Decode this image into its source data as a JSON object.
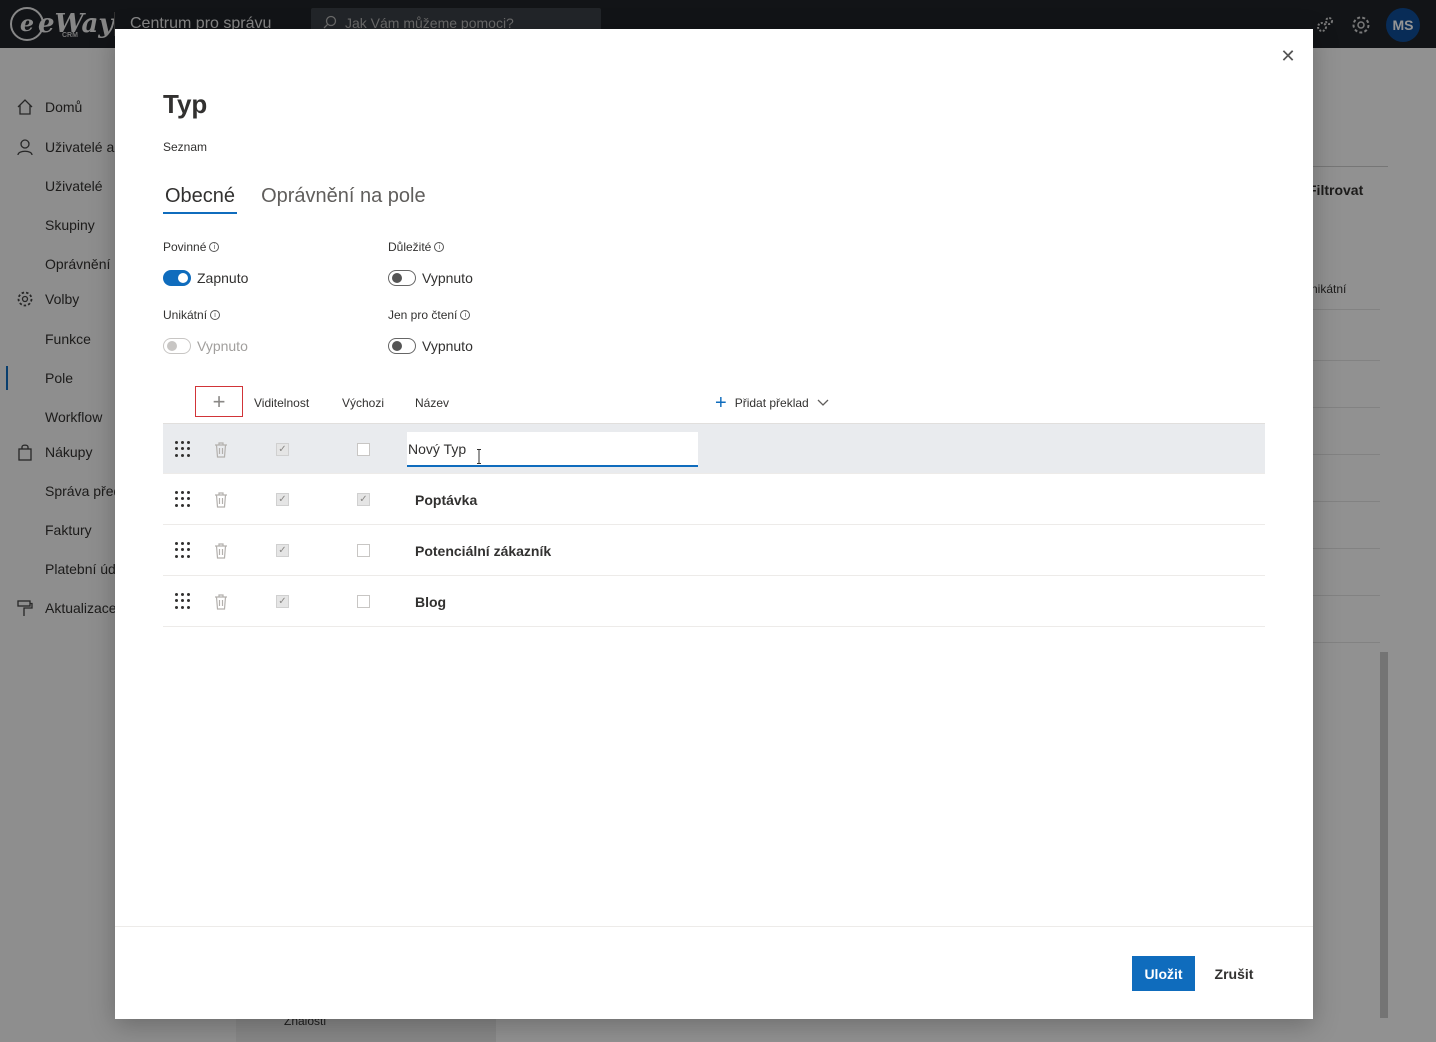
{
  "app": {
    "logo_text": "eWay",
    "logo_sub": "CRM",
    "title": "Centrum pro správu",
    "search_placeholder": "Jak Vám můžeme pomoci?",
    "user_initials": "MS"
  },
  "sidebar": {
    "items": [
      {
        "label": "Domů",
        "icon": "home-icon"
      },
      {
        "label": "Uživatelé a",
        "icon": "person-icon"
      },
      {
        "label": "Uživatelé"
      },
      {
        "label": "Skupiny"
      },
      {
        "label": "Oprávnění n"
      },
      {
        "label": "Volby",
        "icon": "gear-icon"
      },
      {
        "label": "Funkce"
      },
      {
        "label": "Pole"
      },
      {
        "label": "Workflow"
      },
      {
        "label": "Nákupy",
        "icon": "bag-icon"
      },
      {
        "label": "Správa před"
      },
      {
        "label": "Faktury"
      },
      {
        "label": "Platební úd"
      },
      {
        "label": "Aktualizace",
        "icon": "paint-roller-icon"
      }
    ],
    "bottom_label": "Znalosti"
  },
  "background": {
    "filter_label": "Filtrovat",
    "column_label": "nikátní"
  },
  "modal": {
    "title": "Typ",
    "subtitle": "Seznam",
    "tabs": [
      {
        "label": "Obecné",
        "active": true
      },
      {
        "label": "Oprávnění na pole",
        "active": false
      }
    ],
    "fields": {
      "required": {
        "label": "Povinné",
        "value": "Zapnuto",
        "state": "on"
      },
      "important": {
        "label": "Důležité",
        "value": "Vypnuto",
        "state": "off"
      },
      "unique": {
        "label": "Unikátní",
        "value": "Vypnuto",
        "state": "disabled"
      },
      "readonly": {
        "label": "Jen pro čtení",
        "value": "Vypnuto",
        "state": "off"
      }
    },
    "grid": {
      "headers": {
        "visibility": "Viditelnost",
        "default": "Výchozi",
        "name": "Název",
        "add_translation": "Přidat překlad"
      },
      "rows": [
        {
          "name": "Nový Typ",
          "visible": true,
          "default": false,
          "editing": true
        },
        {
          "name": "Poptávka",
          "visible": true,
          "default": true,
          "editing": false
        },
        {
          "name": "Potenciální zákazník",
          "visible": true,
          "default": false,
          "editing": false
        },
        {
          "name": "Blog",
          "visible": true,
          "default": false,
          "editing": false
        }
      ]
    },
    "save_label": "Uložit",
    "cancel_label": "Zrušit",
    "close_icon": "close-icon"
  },
  "colors": {
    "accent": "#0f6cbd",
    "topbar": "#1f2329",
    "highlight_border": "#d13438"
  }
}
